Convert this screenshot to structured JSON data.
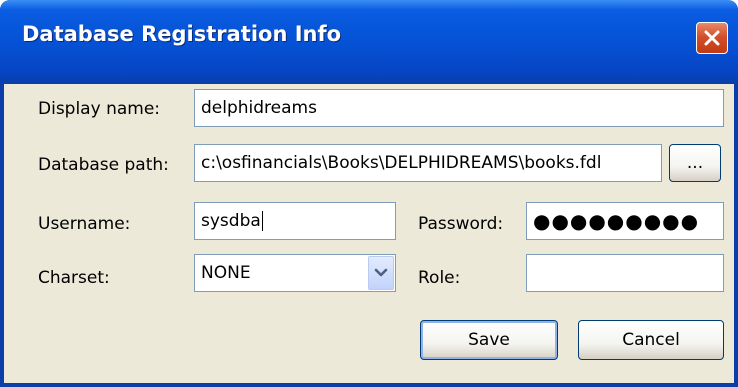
{
  "window": {
    "title": "Database Registration Info"
  },
  "form": {
    "display_name": {
      "label": "Display name:",
      "value": "delphidreams"
    },
    "database_path": {
      "label": "Database path:",
      "value": "c:\\osfinancials\\Books\\DELPHIDREAMS\\books.fdl",
      "browse_label": "..."
    },
    "username": {
      "label": "Username:",
      "value": "sysdba"
    },
    "password": {
      "label": "Password:",
      "value": "●●●●●●●●●"
    },
    "charset": {
      "label": "Charset:",
      "value": "NONE"
    },
    "role": {
      "label": "Role:",
      "value": ""
    }
  },
  "buttons": {
    "save": "Save",
    "cancel": "Cancel"
  },
  "colors": {
    "titlebar": "#0552d6",
    "close": "#c23a14",
    "dialog_bg": "#ece9d8",
    "field_border": "#7f9db9"
  }
}
